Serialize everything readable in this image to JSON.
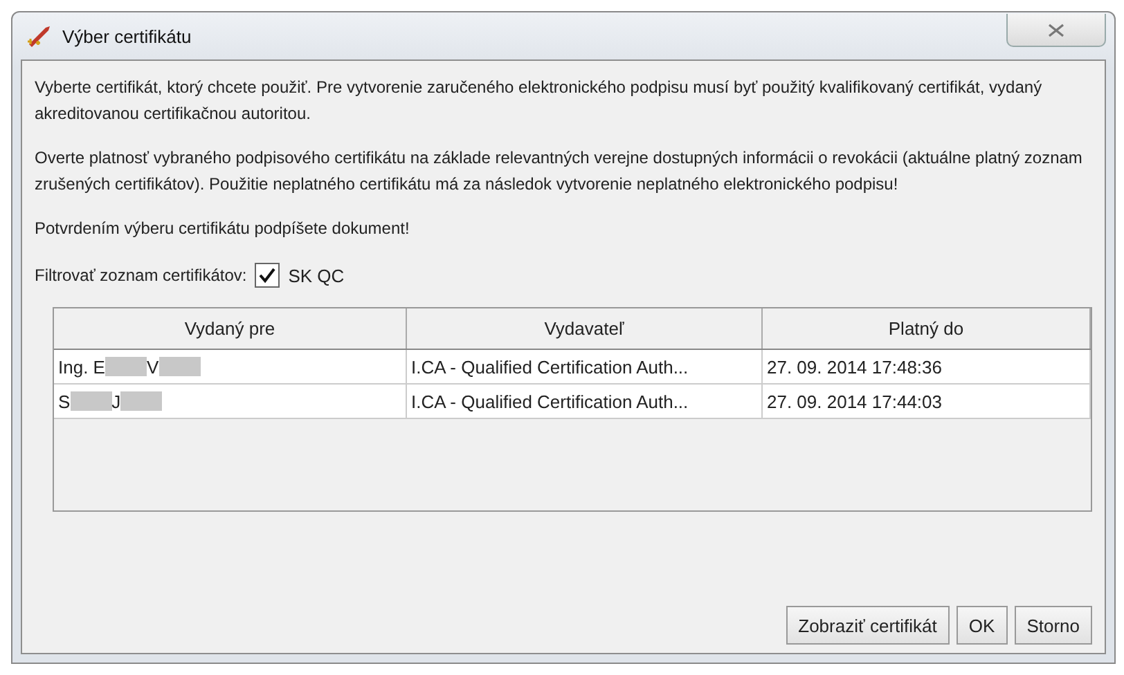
{
  "window": {
    "title": "Výber certifikátu"
  },
  "paragraphs": [
    "Vyberte certifikát, ktorý chcete použiť. Pre vytvorenie zaručeného elektronického podpisu musí byť použitý kvalifikovaný certifikát, vydaný akreditovanou certifikačnou autoritou.",
    "Overte platnosť vybraného podpisového certifikátu na základe relevantných verejne dostupných informácii o revokácii (aktuálne platný zoznam zrušených certifikátov). Použitie neplatného certifikátu má za následok vytvorenie neplatného elektronického podpisu!",
    "Potvrdením výberu certifikátu podpíšete dokument!"
  ],
  "filter": {
    "label": "Filtrovať zoznam certifikátov:",
    "checkbox": {
      "label": "SK QC",
      "checked": true
    }
  },
  "table": {
    "columns": [
      "Vydaný pre",
      "Vydavateľ",
      "Platný do"
    ],
    "rows": [
      {
        "issued_to": [
          {
            "kind": "text",
            "text": "Ing. E"
          },
          {
            "kind": "redaction"
          },
          {
            "kind": "text",
            "text": "V"
          },
          {
            "kind": "redaction"
          }
        ],
        "issuer": "I.CA - Qualified Certification Auth...",
        "valid_to": "27. 09. 2014 17:48:36",
        "selected": false
      },
      {
        "issued_to": [
          {
            "kind": "text",
            "text": "S"
          },
          {
            "kind": "redaction"
          },
          {
            "kind": "text",
            "text": "J"
          },
          {
            "kind": "redaction"
          }
        ],
        "issuer": "I.CA - Qualified Certification Auth...",
        "valid_to": "27. 09. 2014 17:44:03",
        "selected": false
      }
    ]
  },
  "buttons": [
    "Zobraziť certifikát",
    "OK",
    "Storno"
  ]
}
